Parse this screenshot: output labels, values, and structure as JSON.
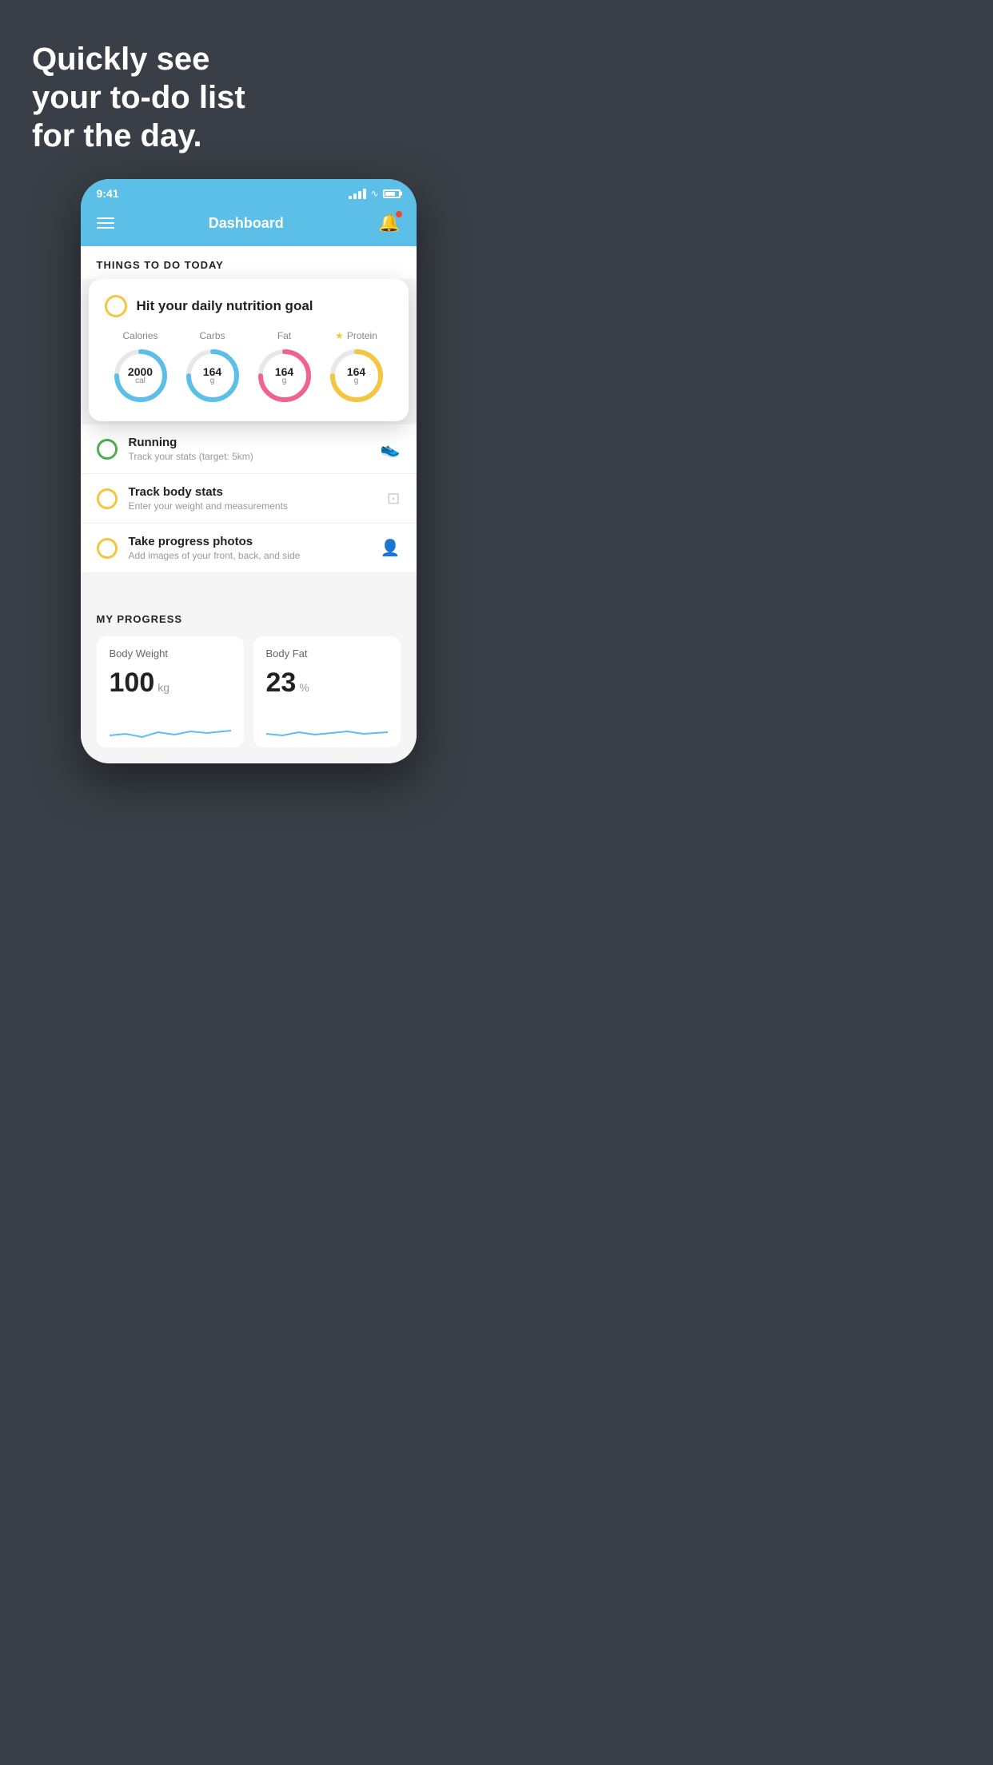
{
  "hero": {
    "text_line1": "Quickly see",
    "text_line2": "your to-do list",
    "text_line3": "for the day."
  },
  "phone": {
    "status_bar": {
      "time": "9:41"
    },
    "header": {
      "title": "Dashboard"
    },
    "things_section": {
      "title": "THINGS TO DO TODAY"
    },
    "nutrition_card": {
      "title": "Hit your daily nutrition goal",
      "stats": [
        {
          "label": "Calories",
          "value": "2000",
          "unit": "cal",
          "color": "blue",
          "starred": false
        },
        {
          "label": "Carbs",
          "value": "164",
          "unit": "g",
          "color": "blue",
          "starred": false
        },
        {
          "label": "Fat",
          "value": "164",
          "unit": "g",
          "color": "red",
          "starred": false
        },
        {
          "label": "Protein",
          "value": "164",
          "unit": "g",
          "color": "yellow",
          "starred": true
        }
      ]
    },
    "todo_items": [
      {
        "name": "Running",
        "sub": "Track your stats (target: 5km)",
        "circle_color": "green",
        "icon": "🏃"
      },
      {
        "name": "Track body stats",
        "sub": "Enter your weight and measurements",
        "circle_color": "yellow",
        "icon": "⚖"
      },
      {
        "name": "Take progress photos",
        "sub": "Add images of your front, back, and side",
        "circle_color": "yellow",
        "icon": "👤"
      }
    ],
    "progress_section": {
      "title": "MY PROGRESS",
      "cards": [
        {
          "title": "Body Weight",
          "value": "100",
          "unit": "kg"
        },
        {
          "title": "Body Fat",
          "value": "23",
          "unit": "%"
        }
      ]
    }
  }
}
